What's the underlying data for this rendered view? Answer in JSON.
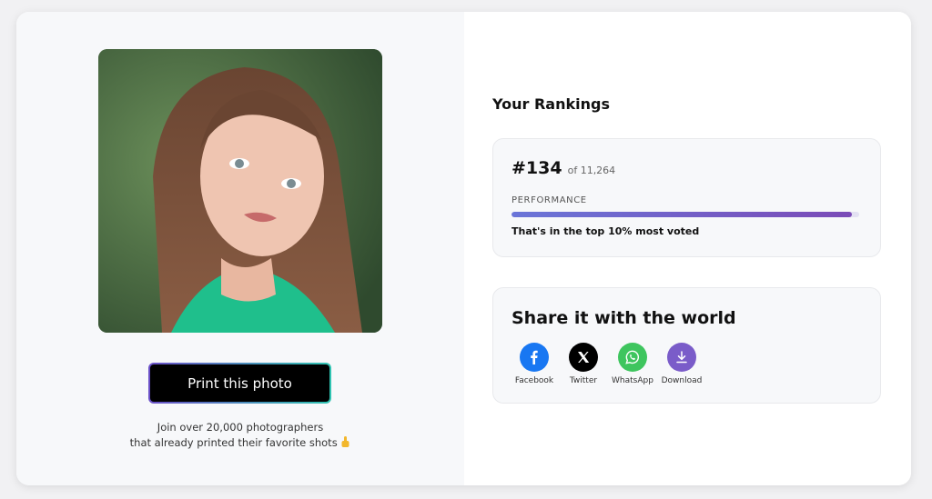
{
  "left": {
    "print_button": "Print this photo",
    "join_line1": "Join over 20,000 photographers",
    "join_line2": "that already printed their favorite shots"
  },
  "rankings": {
    "title": "Your Rankings",
    "rank": "#134",
    "of_total": "of 11,264",
    "performance_label": "PERFORMANCE",
    "performance_fraction": 0.98,
    "performance_text": "That's in the top 10% most voted"
  },
  "share": {
    "title": "Share it with the world",
    "items": [
      {
        "label": "Facebook",
        "icon": "facebook-icon",
        "color": "#1877f2"
      },
      {
        "label": "Twitter",
        "icon": "x-icon",
        "color": "#000000"
      },
      {
        "label": "WhatsApp",
        "icon": "whatsapp-icon",
        "color": "#3ec55e"
      },
      {
        "label": "Download",
        "icon": "download-icon",
        "color": "#7a5cc9"
      }
    ]
  }
}
